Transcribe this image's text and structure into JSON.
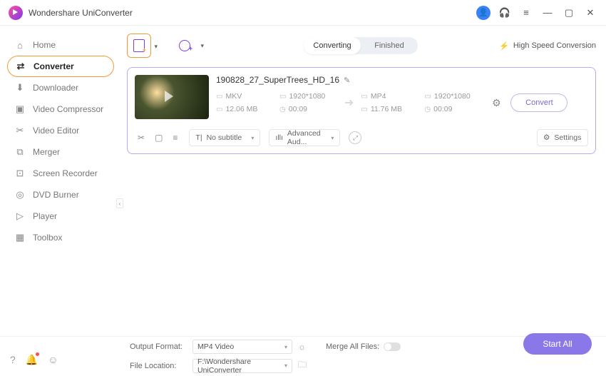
{
  "app": {
    "title": "Wondershare UniConverter"
  },
  "sidebar": {
    "items": [
      {
        "label": "Home"
      },
      {
        "label": "Converter"
      },
      {
        "label": "Downloader"
      },
      {
        "label": "Video Compressor"
      },
      {
        "label": "Video Editor"
      },
      {
        "label": "Merger"
      },
      {
        "label": "Screen Recorder"
      },
      {
        "label": "DVD Burner"
      },
      {
        "label": "Player"
      },
      {
        "label": "Toolbox"
      }
    ]
  },
  "tabs": {
    "converting": "Converting",
    "finished": "Finished"
  },
  "hsc": "High Speed Conversion",
  "file": {
    "name": "190828_27_SuperTrees_HD_16",
    "src": {
      "format": "MKV",
      "resolution": "1920*1080",
      "size": "12.06 MB",
      "duration": "00:09"
    },
    "dst": {
      "format": "MP4",
      "resolution": "1920*1080",
      "size": "11.76 MB",
      "duration": "00:09"
    },
    "convert": "Convert",
    "subtitle": "No subtitle",
    "audio": "Advanced Aud...",
    "settings": "Settings"
  },
  "footer": {
    "output_label": "Output Format:",
    "output_value": "MP4 Video",
    "location_label": "File Location:",
    "location_value": "F:\\Wondershare UniConverter",
    "merge_label": "Merge All Files:",
    "start": "Start All"
  }
}
